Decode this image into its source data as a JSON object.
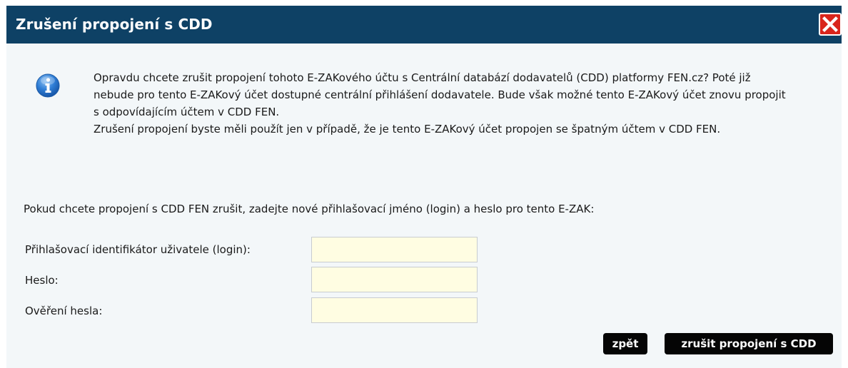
{
  "dialog": {
    "title": "Zrušení propojení s CDD",
    "close_icon": "close-icon",
    "colors": {
      "titlebar": "#0e4165",
      "close": "#d9251c",
      "body": "#f3f7f9",
      "input": "#fffde2",
      "button": "#050505"
    }
  },
  "info": {
    "icon": "info-icon",
    "paragraph1": "Opravdu chcete zrušit propojení tohoto E-ZAKového účtu s Centrální databází dodavatelů (CDD) platformy FEN.cz? Poté již nebude pro tento E-ZAKový účet dostupné centrální přihlášení dodavatele. Bude však možné tento E-ZAKový účet znovu propojit s odpovídajícím účtem v CDD FEN.",
    "paragraph2": "Zrušení propojení byste měli použít jen v případě, že je tento E-ZAKový účet propojen se špatným účtem v CDD FEN."
  },
  "form": {
    "lead": "Pokud chcete propojení s CDD FEN zrušit, zadejte nové přihlašovací jméno (login) a heslo pro tento E-ZAK:",
    "login_label": "Přihlašovací identifikátor uživatele (login):",
    "login_value": "",
    "password_label": "Heslo:",
    "password_value": "",
    "password_confirm_label": "Ověření hesla:",
    "password_confirm_value": ""
  },
  "actions": {
    "back_label": "zpět",
    "cancel_link_label": "zrušit propojení s CDD"
  }
}
